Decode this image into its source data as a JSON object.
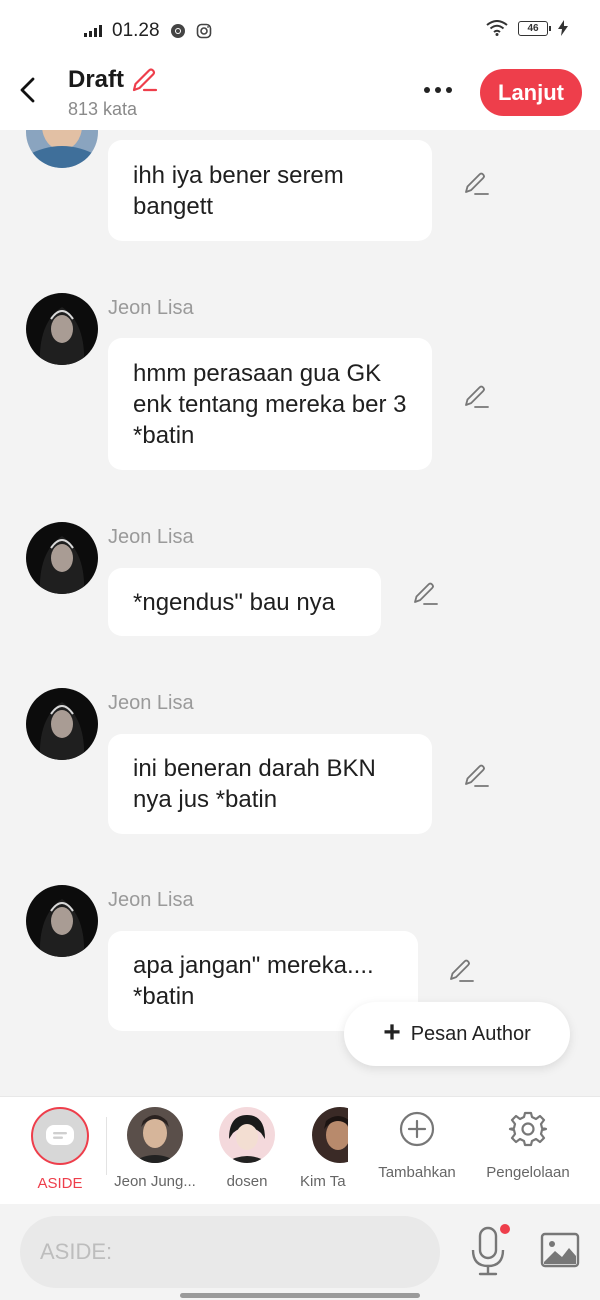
{
  "status_bar": {
    "time": "01.28",
    "battery": "46"
  },
  "header": {
    "title": "Draft",
    "subtitle": "813 kata",
    "next_label": "Lanjut"
  },
  "messages": [
    {
      "sender": "",
      "text": "ihh iya bener serem bangett"
    },
    {
      "sender": "Jeon Lisa",
      "text": "hmm perasaan gua GK enk tentang mereka ber 3 *batin"
    },
    {
      "sender": "Jeon Lisa",
      "text": "*ngendus\" bau nya"
    },
    {
      "sender": "Jeon Lisa",
      "text": "ini beneran darah BKN nya jus *batin"
    },
    {
      "sender": "Jeon Lisa",
      "text": "apa jangan\" mereka.... *batin"
    }
  ],
  "fab": {
    "label": "Pesan Author"
  },
  "characters": [
    {
      "label": "ASIDE",
      "color": "#ee3e4b"
    },
    {
      "label": "Jeon Jung..."
    },
    {
      "label": "dosen"
    },
    {
      "label": "Kim Ta"
    },
    {
      "label": "Tambahkan"
    },
    {
      "label": "Pengelolaan"
    }
  ],
  "composer": {
    "placeholder": "ASIDE:"
  },
  "colors": {
    "accent": "#ee3e4b",
    "background": "#f3f3f3",
    "bubble": "#ffffff"
  }
}
